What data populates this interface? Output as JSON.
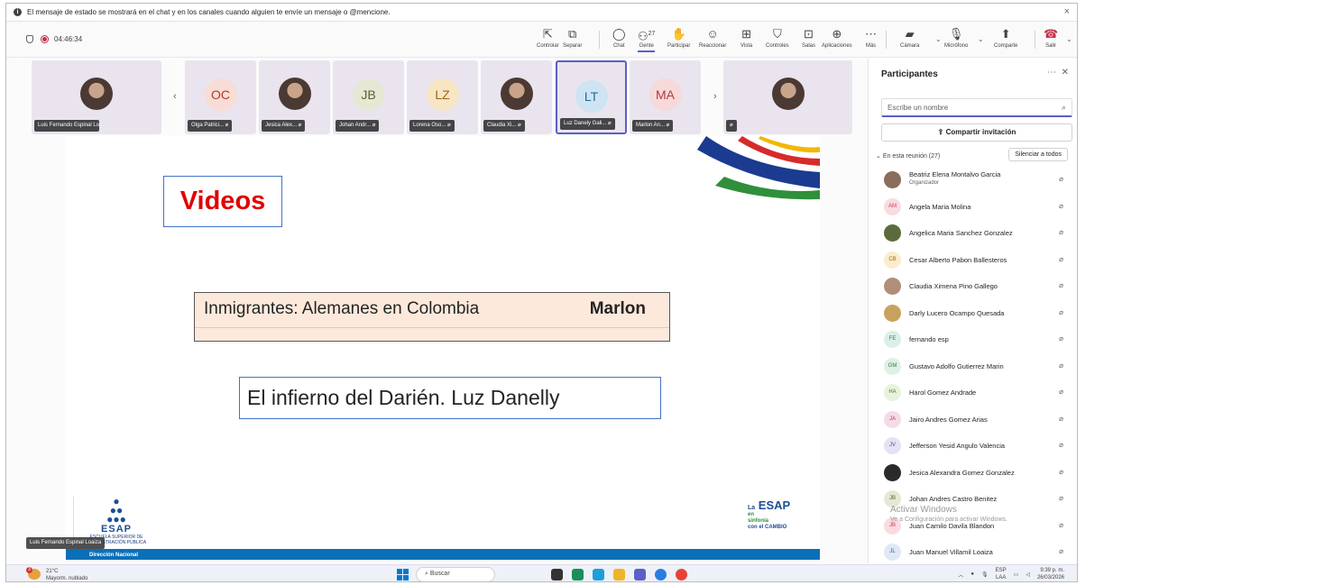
{
  "banner": {
    "text": "El mensaje de estado se mostrará en el chat y en los canales cuando alguien te envíe un mensaje o @mencione.",
    "close": "×"
  },
  "meeting": {
    "timer": "04:46:34"
  },
  "toolbar": {
    "controlar": "Controlar",
    "separar": "Separar",
    "chat": "Chat",
    "gente": "Gente",
    "gente_count": "27",
    "participar": "Participar",
    "reaccionar": "Reaccionar",
    "vista": "Vista",
    "controles": "Controles",
    "salas": "Salas",
    "aplicaciones": "Aplicaciones",
    "mas": "Más",
    "camara": "Cámara",
    "microfono": "Micrófono",
    "comparte": "Comparte",
    "salir": "Salir"
  },
  "strip": {
    "tiles": [
      {
        "name": "Luis Fernando Espinal Loaiza",
        "initials": "",
        "photo": true
      },
      {
        "name": "Olga Patrici...",
        "initials": "OC",
        "photo": false,
        "color": "#f8dcd6",
        "text_color": "#b03a2e"
      },
      {
        "name": "Jesica Alex...",
        "initials": "",
        "photo": true
      },
      {
        "name": "Johan Andr...",
        "initials": "JB",
        "photo": false,
        "color": "#e6e8d4",
        "text_color": "#5c5f2e"
      },
      {
        "name": "Lorena Oso...",
        "initials": "LZ",
        "photo": false,
        "color": "#f6e6c4",
        "text_color": "#a4650f"
      },
      {
        "name": "Claudia Xi...",
        "initials": "",
        "photo": true
      },
      {
        "name": "Luz Danely Gali...",
        "initials": "LT",
        "photo": false,
        "color": "#cfe4f2",
        "text_color": "#1f6a9a"
      },
      {
        "name": "Marlon An...",
        "initials": "MA",
        "photo": false,
        "color": "#f6dada",
        "text_color": "#b43c3c"
      },
      {
        "name": "",
        "initials": "",
        "photo": true
      }
    ]
  },
  "slide": {
    "title": "Videos",
    "topic1": "Inmigrantes: Alemanes en Colombia",
    "presenter1": "Marlon",
    "topic2": "El infierno del Darién. Luz Danelly",
    "footer": "Dirección Nacional",
    "logo_text": "ESCUELA SUPERIOR DE ADMINISTRACIÓN PÚBLICA",
    "logo_word": "ESAP",
    "logo2_la": "La",
    "logo2_word": "ESAP",
    "logo2_en": "en",
    "logo2_sinfonia": "sinfonía",
    "logo2_cambio": "con el CAMBIO"
  },
  "self_view": {
    "name": "Luis Fernando Espinal Loaiza"
  },
  "panel": {
    "title": "Participantes",
    "search_placeholder": "Escribe un nombre",
    "invite": "Compartir invitación",
    "section": "En esta reunión (27)",
    "mute_all": "Silenciar a todos",
    "participants": [
      {
        "name": "Beatriz Elena Montalvo Garcia",
        "role": "Organizador",
        "initials": "",
        "color": "#8a6d5a"
      },
      {
        "name": "Angela Maria Molina",
        "role": "",
        "initials": "AM",
        "color": "#f9dbe0",
        "tc": "#c43c5a"
      },
      {
        "name": "Angelica Maria Sanchez Gonzalez",
        "role": "",
        "initials": "",
        "color": "#5a6b3c"
      },
      {
        "name": "Cesar Alberto Pabon Ballesteros",
        "role": "",
        "initials": "CB",
        "color": "#fbeccd",
        "tc": "#a2690c"
      },
      {
        "name": "Claudia Ximena Pino Gallego",
        "role": "",
        "initials": "",
        "color": "#b08f78"
      },
      {
        "name": "Darly Lucero Ocampo Quesada",
        "role": "",
        "initials": "",
        "color": "#c9a15e"
      },
      {
        "name": "fernando esp",
        "role": "",
        "initials": "FE",
        "color": "#dbefe6",
        "tc": "#2d7a5a"
      },
      {
        "name": "Gustavo Adolfo Gutierrez Marin",
        "role": "",
        "initials": "GM",
        "color": "#dff0e4",
        "tc": "#2f7a45"
      },
      {
        "name": "Harol Gomez Andrade",
        "role": "",
        "initials": "HA",
        "color": "#e8f3dd",
        "tc": "#4c7a28"
      },
      {
        "name": "Jairo Andres Gomez Arias",
        "role": "",
        "initials": "JA",
        "color": "#f6dbe7",
        "tc": "#b03b74"
      },
      {
        "name": "Jefferson Yesid Angulo Valencia",
        "role": "",
        "initials": "JV",
        "color": "#e6e1f3",
        "tc": "#5c4aa0"
      },
      {
        "name": "Jesica Alexandra Gomez Gonzalez",
        "role": "",
        "initials": "",
        "color": "#2a2a2a"
      },
      {
        "name": "Johan Andres Castro Benitez",
        "role": "",
        "initials": "JB",
        "color": "#e6e8d4",
        "tc": "#5c5f2e"
      },
      {
        "name": "Juan Camilo Davila Blandon",
        "role": "",
        "initials": "JB",
        "color": "#f9dbe0",
        "tc": "#c43c5a"
      },
      {
        "name": "Juan Manuel Villamil Loaiza",
        "role": "",
        "initials": "JL",
        "color": "#e1e8f5",
        "tc": "#3a5a9a"
      }
    ]
  },
  "watermark": {
    "line1": "Activar Windows",
    "line2": "Ve a Configuración para activar Windows."
  },
  "taskbar": {
    "weather_temp": "21°C",
    "weather_desc": "Mayorm. nublado",
    "weather_badge": "3",
    "search": "Buscar",
    "lang1": "ESP",
    "lang2": "LAA",
    "time": "9:39 p. m.",
    "date": "26/03/2026"
  },
  "colors": {
    "accent": "#5b5fc7",
    "title_red": "#e10000",
    "leave_red": "#c4314b"
  }
}
